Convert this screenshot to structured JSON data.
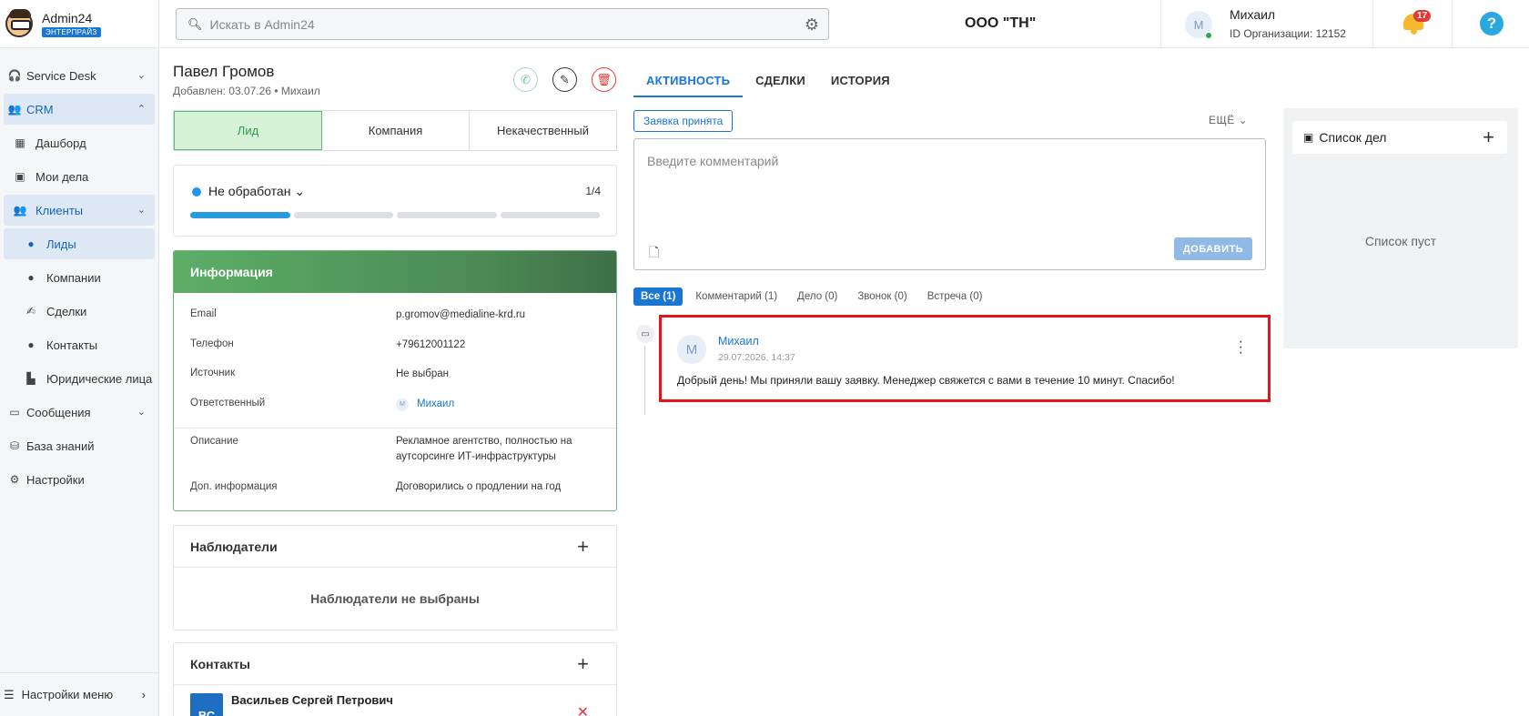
{
  "brand": {
    "name": "Admin24",
    "badge": "ЭНТЕРПРАЙЗ"
  },
  "sidebar": {
    "items": [
      {
        "label": "Service Desk",
        "icon": "headset-icon",
        "chevron": "⌄"
      },
      {
        "label": "CRM",
        "icon": "users-icon",
        "chevron": "⌃"
      },
      {
        "label": "Дашборд",
        "icon": "dashboard-icon"
      },
      {
        "label": "Мои дела",
        "icon": "calendar-check-icon"
      },
      {
        "label": "Клиенты",
        "icon": "users-icon",
        "chevron": "⌄"
      },
      {
        "label": "Лиды",
        "icon": "person-icon"
      },
      {
        "label": "Компании",
        "icon": "person-icon"
      },
      {
        "label": "Сделки",
        "icon": "handshake-icon"
      },
      {
        "label": "Контакты",
        "icon": "person-icon"
      },
      {
        "label": "Юридические лица",
        "icon": "building-icon"
      },
      {
        "label": "Сообщения",
        "icon": "chat-icon",
        "chevron": "⌄"
      },
      {
        "label": "База знаний",
        "icon": "database-icon"
      },
      {
        "label": "Настройки",
        "icon": "gear-icon"
      }
    ],
    "bottom_label": "Настройки меню"
  },
  "header": {
    "search_placeholder": "Искать в Admin24",
    "org_name": "ООО \"ТН\"",
    "user_initial": "М",
    "user_name": "Михаил",
    "user_org_id": "ID Организации: 12152",
    "notifications_count": "17",
    "help_label": "?"
  },
  "lead": {
    "name": "Павел Громов",
    "subtitle": "Добавлен: 03.07.26 • Михаил",
    "type_options": [
      "Лид",
      "Компания",
      "Некачественный"
    ],
    "status": "Не обработан",
    "stage_progress": "1/4",
    "stages_total": 4,
    "stages_done": 1
  },
  "info": {
    "title": "Информация",
    "email_label": "Email",
    "email": "p.gromov@medialine-krd.ru",
    "phone_label": "Телефон",
    "phone": "+79612001122",
    "source_label": "Источник",
    "source": "Не выбран",
    "owner_label": "Ответственный",
    "owner_initial": "М",
    "owner": "Михаил",
    "description_label": "Описание",
    "description": "Рекламное агентство, полностью на аутсорсинге ИТ-инфраструктуры",
    "extra_label": "Доп. информация",
    "extra": "Договорились о продлении на год"
  },
  "observers": {
    "title": "Наблюдатели",
    "empty": "Наблюдатели не выбраны"
  },
  "contacts": {
    "title": "Контакты",
    "items": [
      {
        "initials": "ВС",
        "name": "Васильев Сергей Петрович"
      }
    ]
  },
  "activity": {
    "tabs": [
      "АКТИВНОСТЬ",
      "СДЕЛКИ",
      "ИСТОРИЯ"
    ],
    "chip": "Заявка принята",
    "more": "ЕЩЁ",
    "comment_placeholder": "Введите комментарий",
    "add_button": "ДОБАВИТЬ",
    "filters": [
      "Все (1)",
      "Комментарий (1)",
      "Дело (0)",
      "Звонок (0)",
      "Встреча (0)"
    ],
    "items": [
      {
        "initial": "М",
        "author": "Михаил",
        "time": "29.07.2026, 14:37",
        "text": "Добрый день! Мы приняли вашу заявку. Менеджер свяжется с вами в течение 10 минут. Спасибо!"
      }
    ]
  },
  "todo": {
    "title": "Список дел",
    "empty": "Список пуст"
  }
}
